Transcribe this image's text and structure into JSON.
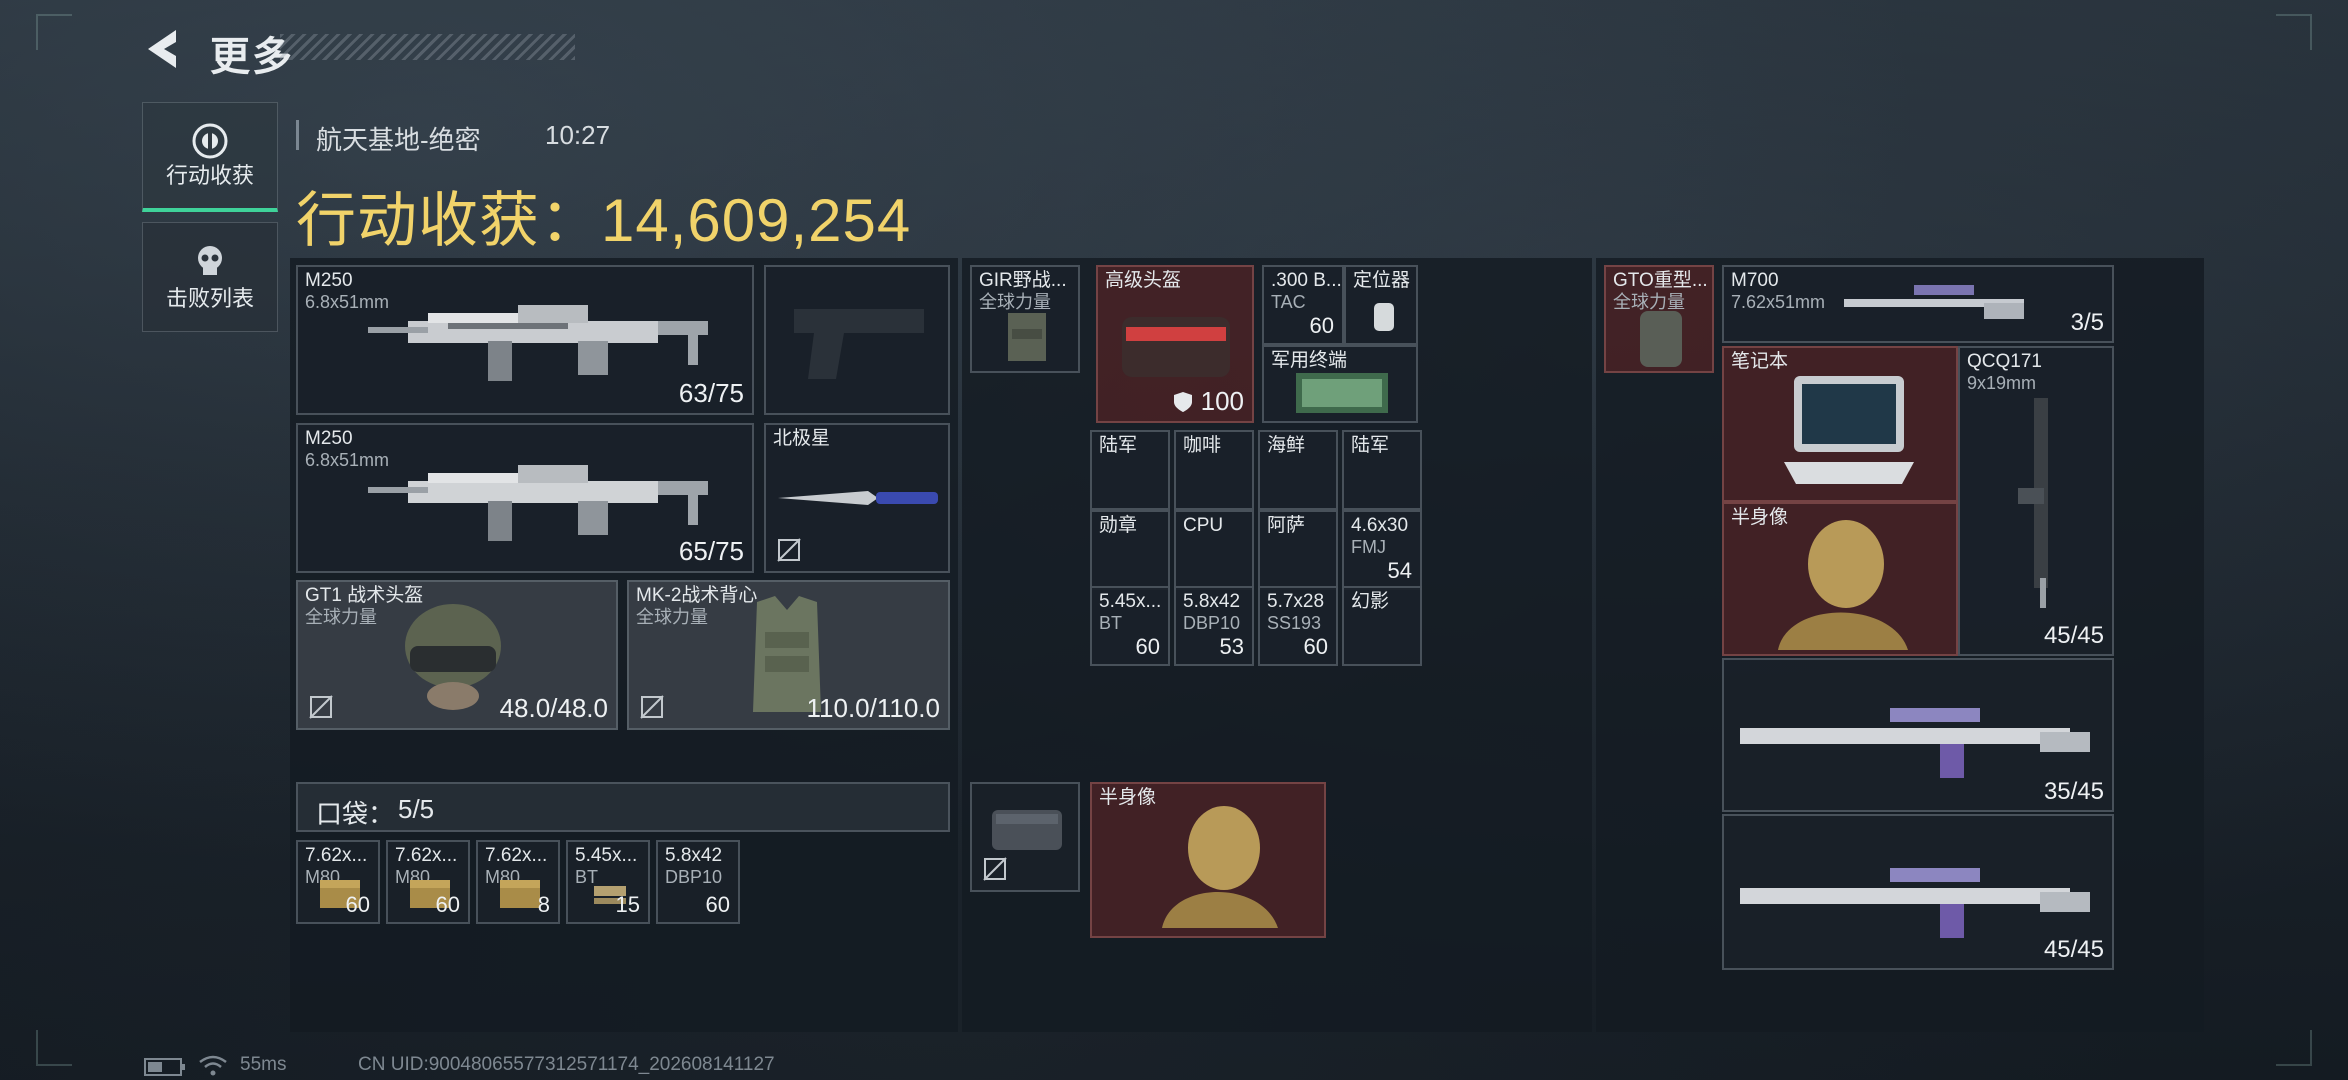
{
  "header": {
    "title": "更多"
  },
  "tabs": {
    "loot": "行动收获",
    "kills": "击败列表"
  },
  "raid": {
    "map": "航天基地-绝密",
    "time": "10:27",
    "loot_total": "行动收获：14,609,254"
  },
  "equipment": {
    "primary1": {
      "name": "M250",
      "caliber": "6.8x51mm",
      "ammo": "63/75"
    },
    "primary2": {
      "name": "M250",
      "caliber": "6.8x51mm",
      "ammo": "65/75"
    },
    "melee": {
      "name": "北极星"
    },
    "helmet": {
      "name": "GT1 战术头盔",
      "brand": "全球力量",
      "durability": "48.0/48.0"
    },
    "armor": {
      "name": "MK-2战术背心",
      "brand": "全球力量",
      "durability": "110.0/110.0"
    }
  },
  "pocket": {
    "label": "口袋：",
    "count": "5/5",
    "items": [
      {
        "name": "7.62x...",
        "sub": "M80",
        "count": "60"
      },
      {
        "name": "7.62x...",
        "sub": "M80",
        "count": "60"
      },
      {
        "name": "7.62x...",
        "sub": "M80",
        "count": "8"
      },
      {
        "name": "5.45x...",
        "sub": "BT",
        "count": "15"
      },
      {
        "name": "5.8x42",
        "sub": "DBP10",
        "count": "60"
      }
    ]
  },
  "chest_rig": {
    "rig": {
      "name": "GIR野战...",
      "brand": "全球力量"
    },
    "items": [
      {
        "name": "高级头盔",
        "count": "100"
      },
      {
        "name": ".300 B...",
        "sub": "TAC",
        "count": "60"
      },
      {
        "name": "定位器"
      },
      {
        "name": "军用终端"
      },
      {
        "name": "陆军"
      },
      {
        "name": "咖啡"
      },
      {
        "name": "海鲜"
      },
      {
        "name": "陆军"
      },
      {
        "name": "勋章"
      },
      {
        "name": "CPU"
      },
      {
        "name": "阿萨"
      },
      {
        "name": "4.6x30",
        "sub": "FMJ",
        "count": "54"
      },
      {
        "name": "5.45x...",
        "sub": "BT",
        "count": "60"
      },
      {
        "name": "5.8x42",
        "sub": "DBP10",
        "count": "53"
      },
      {
        "name": "5.7x28",
        "sub": "SS193",
        "count": "60"
      },
      {
        "name": "幻影"
      }
    ]
  },
  "safe_box": {
    "item": "半身像"
  },
  "backpack": {
    "bag": {
      "name": "GTO重型...",
      "brand": "全球力量"
    },
    "items": [
      {
        "name": "M700",
        "caliber": "7.62x51mm",
        "ammo": "3/5"
      },
      {
        "name": "笔记本"
      },
      {
        "name": "QCQ171",
        "caliber": "9x19mm",
        "ammo": "45/45"
      },
      {
        "name": "半身像"
      },
      {
        "ammo": "35/45"
      },
      {
        "ammo": "45/45"
      }
    ]
  },
  "footer": {
    "ping": "55ms",
    "uid": "CN UID:90048065577312571174_202608141127"
  },
  "colors": {
    "accent": "#3fd39a",
    "loot_value": "#f1d36a",
    "rare_bg": "#48222",
    "bg": "#1c242c"
  }
}
